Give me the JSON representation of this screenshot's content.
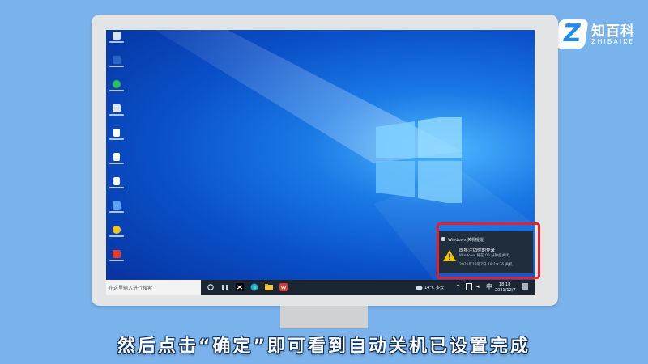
{
  "brand": {
    "mark": "Z",
    "name_cn": "知百科",
    "name_en": "ZHIBAIKE"
  },
  "desktop": {
    "icons": [
      {
        "name": "recycle-bin",
        "color": "#d9e6f2"
      },
      {
        "name": "app-1",
        "color": "#2b66c8"
      },
      {
        "name": "wechat",
        "color": "#2dc35b"
      },
      {
        "name": "computer",
        "color": "#dfe9f3"
      },
      {
        "name": "document-1",
        "color": "#ffffff"
      },
      {
        "name": "document-2",
        "color": "#ffffff"
      },
      {
        "name": "document-3",
        "color": "#ffffff"
      },
      {
        "name": "app-2",
        "color": "#5aa0ea"
      },
      {
        "name": "app-3",
        "color": "#f5c518"
      },
      {
        "name": "app-4",
        "color": "#e23c32"
      }
    ]
  },
  "notification": {
    "app_name": "Windows 关机提醒",
    "title": "即将注销你的登录",
    "body": "Windows 将在 00 分钟后关闭。",
    "time": "2021年12月7日 18:19:26 关机"
  },
  "taskbar": {
    "search_placeholder": "在这里输入进行搜索",
    "weather": "14°C 多云",
    "time": "18:18",
    "date": "2021/12/7"
  },
  "subtitle": "然后点击“确定”即可看到自动关机已设置完成",
  "colors": {
    "highlight": "#e8202b",
    "desktop_blue": "#0a4fc7",
    "taskbar": "#1c2633",
    "background": "#7ab3ec"
  }
}
